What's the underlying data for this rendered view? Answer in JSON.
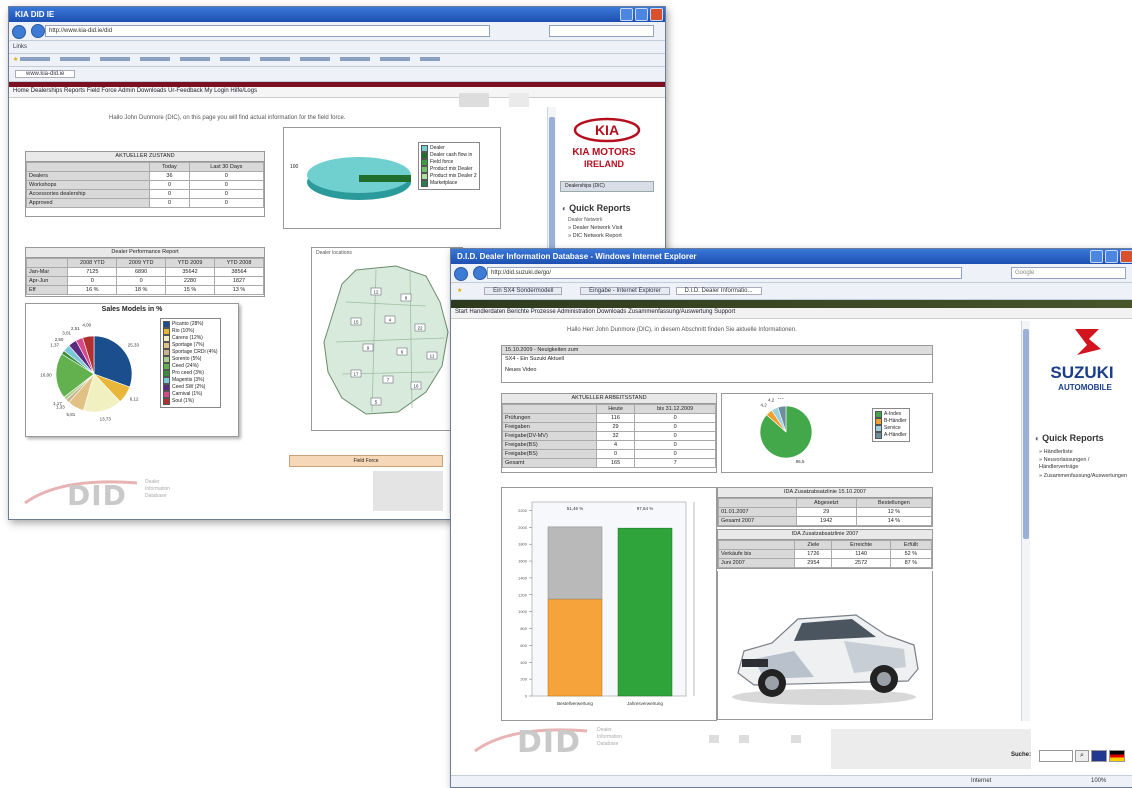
{
  "kia_window": {
    "title": "KIA DID IE",
    "url": "http://www.kia-did.ie/did",
    "links_bar_label": "Links",
    "tab_label": "www.kia-did.ie",
    "nav_links": "Home  Dealerships  Reports  Field Force  Admin  Downloads  Ur-Feedback  My Login  Hilfe/Logs",
    "welcome": "Hallo John Dunmore (DIC), on this page you will find actual information for the field force.",
    "status_table": {
      "title": "AKTUELLER ZUSTAND",
      "headers": [
        "",
        "Today",
        "Last 30 Days"
      ],
      "rows": [
        [
          "Dealers",
          "36",
          "0"
        ],
        [
          "Workshops",
          "0",
          "0"
        ],
        [
          "Accessories dealership",
          "0",
          "0"
        ],
        [
          "Approved",
          "0",
          "0"
        ]
      ]
    },
    "perf_table": {
      "title": "Dealer Performance Report",
      "headers": [
        "",
        "2008 YTD",
        "2009 YTD",
        "YTD 2009",
        "YTD 2008"
      ],
      "rows": [
        [
          "Jan-Mar",
          "7125",
          "6890",
          "35642",
          "38564"
        ],
        [
          "Apr-Jun",
          "0",
          "0",
          "2280",
          "1827"
        ],
        [
          "Eff",
          "16 %",
          "18 %",
          "15 %",
          "13 %"
        ]
      ]
    },
    "ring_chart": {
      "label_left": "100",
      "legend": [
        "Dealer",
        "Dealer cash flow in",
        "Field force",
        "Product mix Dealer",
        "Product mix Dealer 2",
        "Marketplace"
      ],
      "colors": [
        "#6fd0cf",
        "#1f6e2d",
        "#3d9a45",
        "#71c06c",
        "#b0e0a0",
        "#2b7c55"
      ]
    },
    "map_title": "Dealer locations",
    "map_numbers": [
      "12",
      "8",
      "15",
      "4",
      "22",
      "9",
      "6",
      "11",
      "17",
      "7",
      "16",
      "5"
    ],
    "field_force_label": "Field Force",
    "sidebar": {
      "brand_line1": "KIA MOTORS",
      "brand_line2": "IRELAND",
      "dropdown": "Dealerships (DIC)",
      "quick_reports_title": "Quick Reports",
      "quick_reports_sub": "Dealer Network",
      "links": [
        "Dealer Network Visit",
        "DIC Network Report"
      ]
    },
    "did_logo_letters": "DID",
    "did_logo_text": [
      "Dealer",
      "Information",
      "Database"
    ]
  },
  "kia_pie": {
    "chart_data": {
      "type": "pie",
      "title": "Sales Models in %",
      "labels": [
        "Picanto (28%)",
        "Rio (10%)",
        "Carens (12%)",
        "Sportage (7%)",
        "Sportage CRDi (4%)",
        "Sorento (5%)",
        "Ceed (24%)",
        "Pro ceed (3%)",
        "Magentis (3%)",
        "Ceed SW (2%)",
        "Carnival (1%)",
        "Soul (1%)"
      ],
      "values": [
        25.33,
        6.12,
        13.73,
        5.81,
        1.33,
        1.17,
        16.0,
        1.37,
        2.5,
        3.01,
        2.51,
        4.0
      ],
      "value_labels": [
        "25,33",
        "6,12",
        "13,73",
        "5,81",
        "1,33",
        "1,17",
        "16,00",
        "1,37",
        "2,50",
        "3,01",
        "2,51",
        "4,00"
      ],
      "colors": [
        "#1b4e8c",
        "#e8b73a",
        "#f0f0c0",
        "#e2c185",
        "#c8b48c",
        "#a8d08a",
        "#63b04e",
        "#3c8c3c",
        "#7bc6d8",
        "#5a2b80",
        "#d44a8a",
        "#b03030"
      ]
    }
  },
  "suzuki_window": {
    "title": "D.I.D. Dealer Information Database - Windows Internet Explorer",
    "url": "http://did.suzuki.de/go/",
    "search_placeholder": "Google",
    "tabs": [
      "Ein SX4 Sondermodell",
      "Eingabe - Internet Explorer",
      "D.I.D. Dealer Informatio..."
    ],
    "nav_links": "Start  Handlerdaten  Berichte  Prozesse  Administration  Downloads  Zusammenfassung/Auswertung  Support",
    "welcome": "Hallo Herr John Dunmore (DIC), in diesem Abschnitt finden Sie aktuelle Informationen.",
    "news_box": {
      "date": "15.10.2009 - Neuigkeiten zum",
      "line1": "SX4 - Ein Suzuki Aktuell",
      "line2": "Neues Video"
    },
    "status_table": {
      "title": "AKTUELLER ARBEITSSTAND",
      "headers": [
        "",
        "Heute",
        "bis 31.12.2009"
      ],
      "rows": [
        [
          "Prüfungen",
          "116",
          "0"
        ],
        [
          "Freigaben",
          "29",
          "0"
        ],
        [
          "Freigabe(DV-MV)",
          "32",
          "0"
        ],
        [
          "Freigabe(BS)",
          "4",
          "0"
        ],
        [
          "Freigabe(BS)",
          "0",
          "0"
        ],
        [
          "Gesamt",
          "165",
          "7"
        ]
      ]
    },
    "mini_pie": {
      "chart_data": {
        "type": "pie",
        "labels": [
          "A-Index",
          "B-Händler",
          "Service",
          "A-Händler"
        ],
        "values": [
          86.5,
          4.2,
          4.2,
          5.1
        ],
        "value_labels": [
          "86,5",
          "4,2",
          "4,2",
          "5,1"
        ],
        "colors": [
          "#43a84a",
          "#f0a030",
          "#9ad0e0",
          "#6e8e9e"
        ]
      }
    },
    "bar_chart": {
      "chart_data": {
        "type": "bar",
        "categories": [
          "Bestellverwertung",
          "Jahresverwertung"
        ],
        "series": [
          {
            "values": [
              1150,
              1990
            ]
          },
          {
            "values": [
              2005,
              0
            ]
          }
        ],
        "value_labels": [
          "51,46 %",
          "97,64 %"
        ],
        "colors": [
          "#f5a33a",
          "#b9b9b9",
          "#2ea43a"
        ],
        "ylim": [
          0,
          2300
        ]
      }
    },
    "zs_table1": {
      "title": "IDA Zusatzabsatzlinie 15.10.2007",
      "headers": [
        "",
        "Abgesetzt",
        "Bestellungen"
      ],
      "rows": [
        [
          "01.01.2007",
          "29",
          "12 %"
        ],
        [
          "Gesamt 2007",
          "1942",
          "14 %"
        ]
      ]
    },
    "zs_table2": {
      "title": "IDA Zusatzabsatzlinie 2007",
      "headers": [
        "",
        "Ziele",
        "Erreichte",
        "Erfüllt"
      ],
      "rows": [
        [
          "Verkäufe bis",
          "1726",
          "1140",
          "52 %"
        ],
        [
          "Juni 2007",
          "2954",
          "2572",
          "87 %"
        ]
      ]
    },
    "sidebar": {
      "brand_line1": "SUZUKI",
      "brand_line2": "AUTOMOBILE",
      "quick_reports_title": "Quick Reports",
      "links": [
        "Händlerliste",
        "Neuvorlassungen / Händlerverträge",
        "Zusammenfassung/Auswertungen"
      ]
    },
    "did_logo_letters": "DID",
    "did_logo_text": [
      "Dealer",
      "Information",
      "Database"
    ],
    "search_label": "Suche:",
    "status_left": "Internet",
    "status_right": "100%"
  }
}
